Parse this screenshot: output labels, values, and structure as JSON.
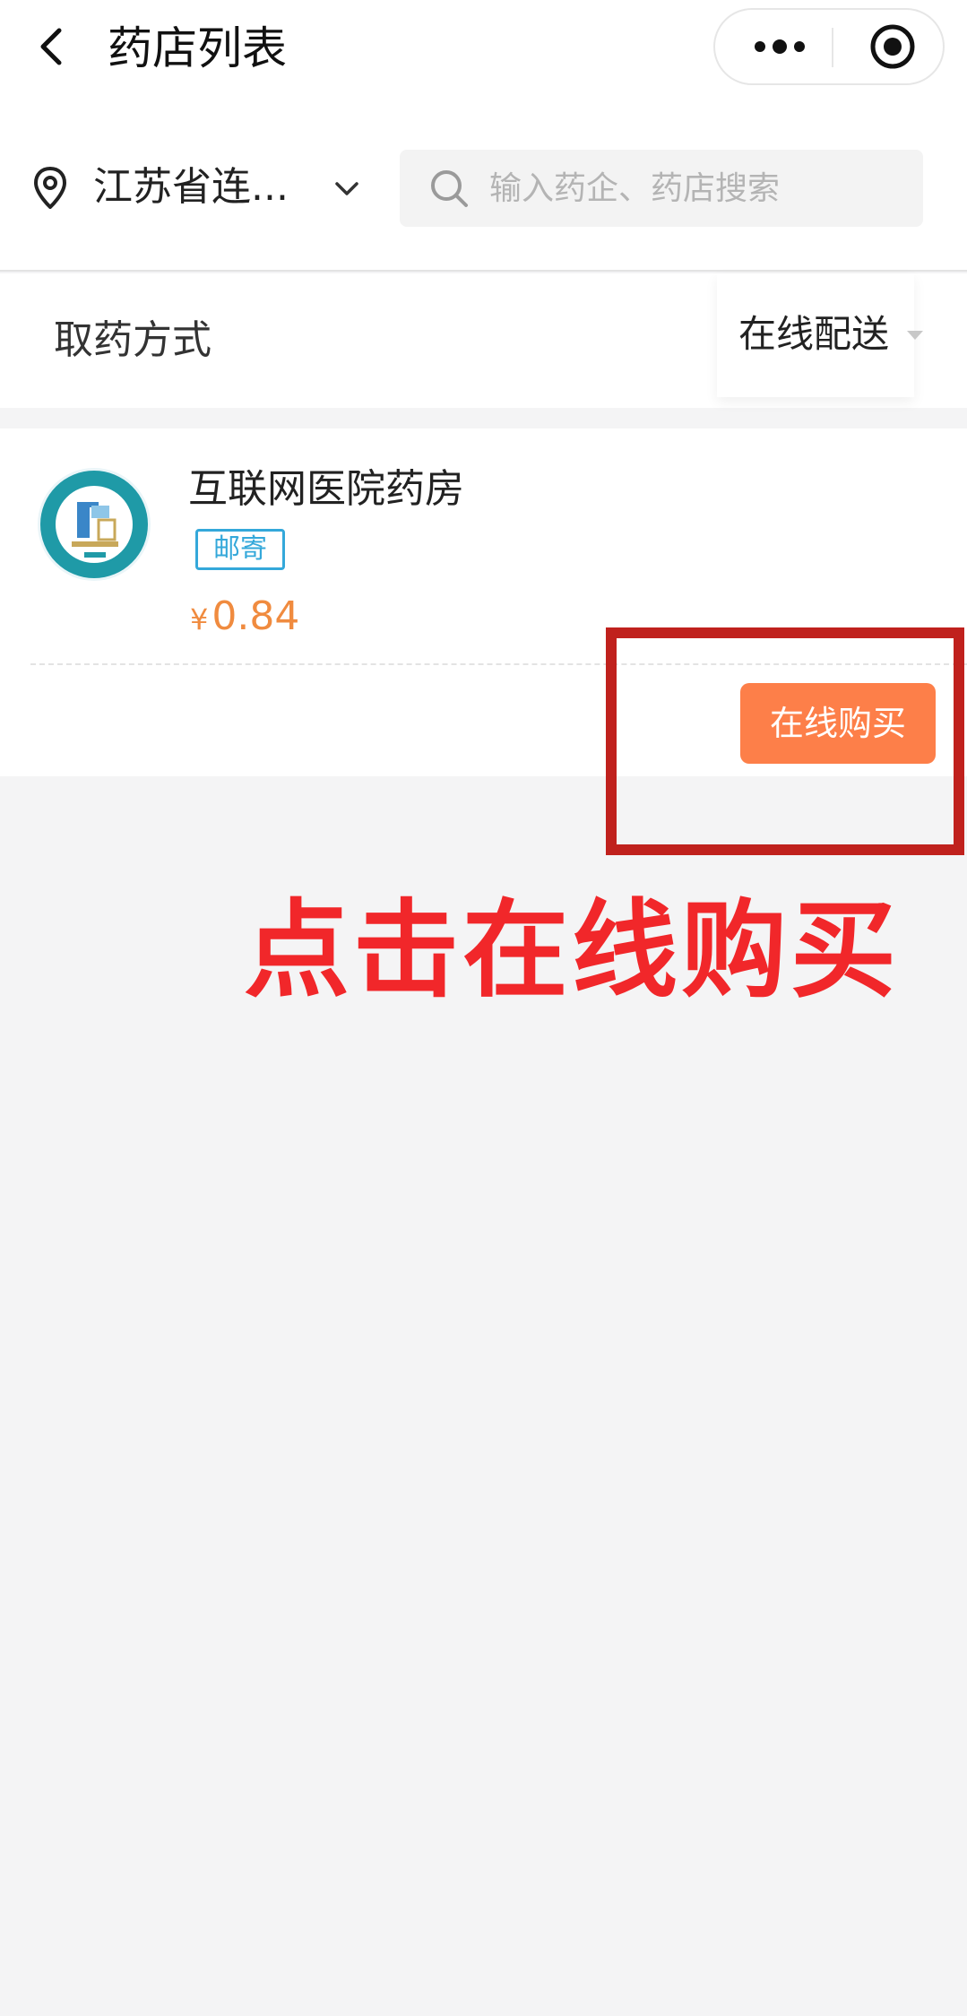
{
  "header": {
    "title": "药店列表",
    "back_icon": "chevron-left-icon",
    "more_icon": "more-dots-icon",
    "close_icon": "target-circle-icon"
  },
  "location": {
    "label": "江苏省连...",
    "pin_icon": "location-pin-icon",
    "dropdown_icon": "chevron-down-icon"
  },
  "search": {
    "placeholder": "输入药企、药店搜索",
    "value": "",
    "icon": "search-icon"
  },
  "filter": {
    "label": "取药方式",
    "selected": "在线配送",
    "caret_icon": "caret-down-icon"
  },
  "pharmacies": [
    {
      "name": "互联网医院药房",
      "logo_icon": "hospital-logo-icon",
      "tag": "邮寄",
      "currency": "¥",
      "price": "0.84",
      "buy_label": "在线购买"
    }
  ],
  "annotation": {
    "text": "点击在线购买"
  },
  "colors": {
    "accent_orange": "#fd7f49",
    "price_orange": "#f08b3f",
    "tag_blue": "#34a8da",
    "annotation_red": "#f1272a",
    "highlight_red": "#c0211d",
    "page_bg": "#f4f4f5"
  }
}
